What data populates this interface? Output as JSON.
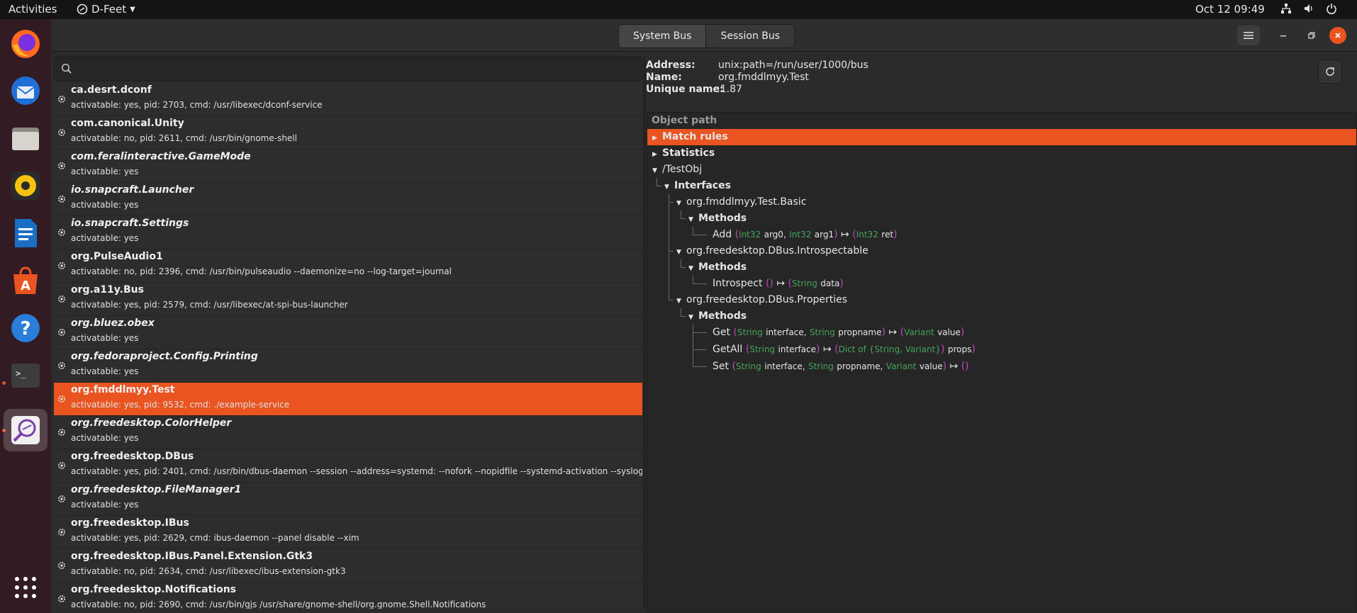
{
  "topbar": {
    "activities": "Activities",
    "app_name": "D-Feet",
    "clock": "Oct 12  09:49"
  },
  "dock": {
    "items": [
      {
        "name": "firefox-icon"
      },
      {
        "name": "thunderbird-icon"
      },
      {
        "name": "files-icon"
      },
      {
        "name": "rhythmbox-icon"
      },
      {
        "name": "libreoffice-writer-icon"
      },
      {
        "name": "software-center-icon"
      },
      {
        "name": "help-icon"
      },
      {
        "name": "terminal-icon"
      },
      {
        "name": "d-feet-icon"
      },
      {
        "name": "show-apps-icon"
      }
    ]
  },
  "header": {
    "system_bus": "System Bus",
    "session_bus": "Session Bus"
  },
  "search": {
    "placeholder": ""
  },
  "bus_list": [
    {
      "name": "ca.desrt.dconf",
      "italic": false,
      "desc": "activatable: yes, pid: 2703, cmd: /usr/libexec/dconf-service"
    },
    {
      "name": "com.canonical.Unity",
      "italic": false,
      "desc": "activatable: no, pid: 2611, cmd: /usr/bin/gnome-shell"
    },
    {
      "name": "com.feralinteractive.GameMode",
      "italic": true,
      "desc": "activatable: yes"
    },
    {
      "name": "io.snapcraft.Launcher",
      "italic": true,
      "desc": "activatable: yes"
    },
    {
      "name": "io.snapcraft.Settings",
      "italic": true,
      "desc": "activatable: yes"
    },
    {
      "name": "org.PulseAudio1",
      "italic": false,
      "desc": "activatable: no, pid: 2396, cmd: /usr/bin/pulseaudio --daemonize=no --log-target=journal"
    },
    {
      "name": "org.a11y.Bus",
      "italic": false,
      "desc": "activatable: yes, pid: 2579, cmd: /usr/libexec/at-spi-bus-launcher"
    },
    {
      "name": "org.bluez.obex",
      "italic": true,
      "desc": "activatable: yes"
    },
    {
      "name": "org.fedoraproject.Config.Printing",
      "italic": true,
      "desc": "activatable: yes"
    },
    {
      "name": "org.fmddlmyy.Test",
      "italic": false,
      "desc": "activatable: yes, pid: 9532, cmd: ./example-service",
      "selected": true
    },
    {
      "name": "org.freedesktop.ColorHelper",
      "italic": true,
      "desc": "activatable: yes"
    },
    {
      "name": "org.freedesktop.DBus",
      "italic": false,
      "desc": "activatable: yes, pid: 2401, cmd: /usr/bin/dbus-daemon --session --address=systemd: --nofork --nopidfile --systemd-activation --syslog-only"
    },
    {
      "name": "org.freedesktop.FileManager1",
      "italic": true,
      "desc": "activatable: yes"
    },
    {
      "name": "org.freedesktop.IBus",
      "italic": false,
      "desc": "activatable: yes, pid: 2629, cmd: ibus-daemon --panel disable --xim"
    },
    {
      "name": "org.freedesktop.IBus.Panel.Extension.Gtk3",
      "italic": false,
      "desc": "activatable: no, pid: 2634, cmd: /usr/libexec/ibus-extension-gtk3"
    },
    {
      "name": "org.freedesktop.Notifications",
      "italic": false,
      "desc": "activatable: no, pid: 2690, cmd: /usr/bin/gjs /usr/share/gnome-shell/org.gnome.Shell.Notifications"
    }
  ],
  "info": {
    "address_label": "Address:",
    "address_value": "unix:path=/run/user/1000/bus",
    "name_label": "Name:",
    "name_value": "org.fmddlmyy.Test",
    "unique_label": "Unique name:",
    "unique_value": ":1.87"
  },
  "tree": {
    "header": "Object path",
    "match_rules": "Match rules",
    "statistics": "Statistics",
    "object_path": "/TestObj",
    "interfaces": "Interfaces",
    "iface1": "org.fmddlmyy.Test.Basic",
    "methods": "Methods",
    "m_add": "Add",
    "iface2": "org.freedesktop.DBus.Introspectable",
    "m_introspect": "Introspect",
    "iface3": "org.freedesktop.DBus.Properties",
    "m_get": "Get",
    "m_getall": "GetAll",
    "m_set": "Set",
    "t_int32": "Int32",
    "t_string": "String",
    "t_variant": "Variant",
    "t_dict": "Dict of {String, Variant}",
    "p_arg0": "arg0,",
    "p_arg1": "arg1",
    "p_ret": "ret",
    "p_data": "data",
    "p_interface_c": "interface,",
    "p_interface": "interface",
    "p_propname_c": "propname,",
    "p_propname": "propname",
    "p_value": "value",
    "p_props": "props",
    "maps_to": "↦",
    "empty_parens": "()"
  }
}
